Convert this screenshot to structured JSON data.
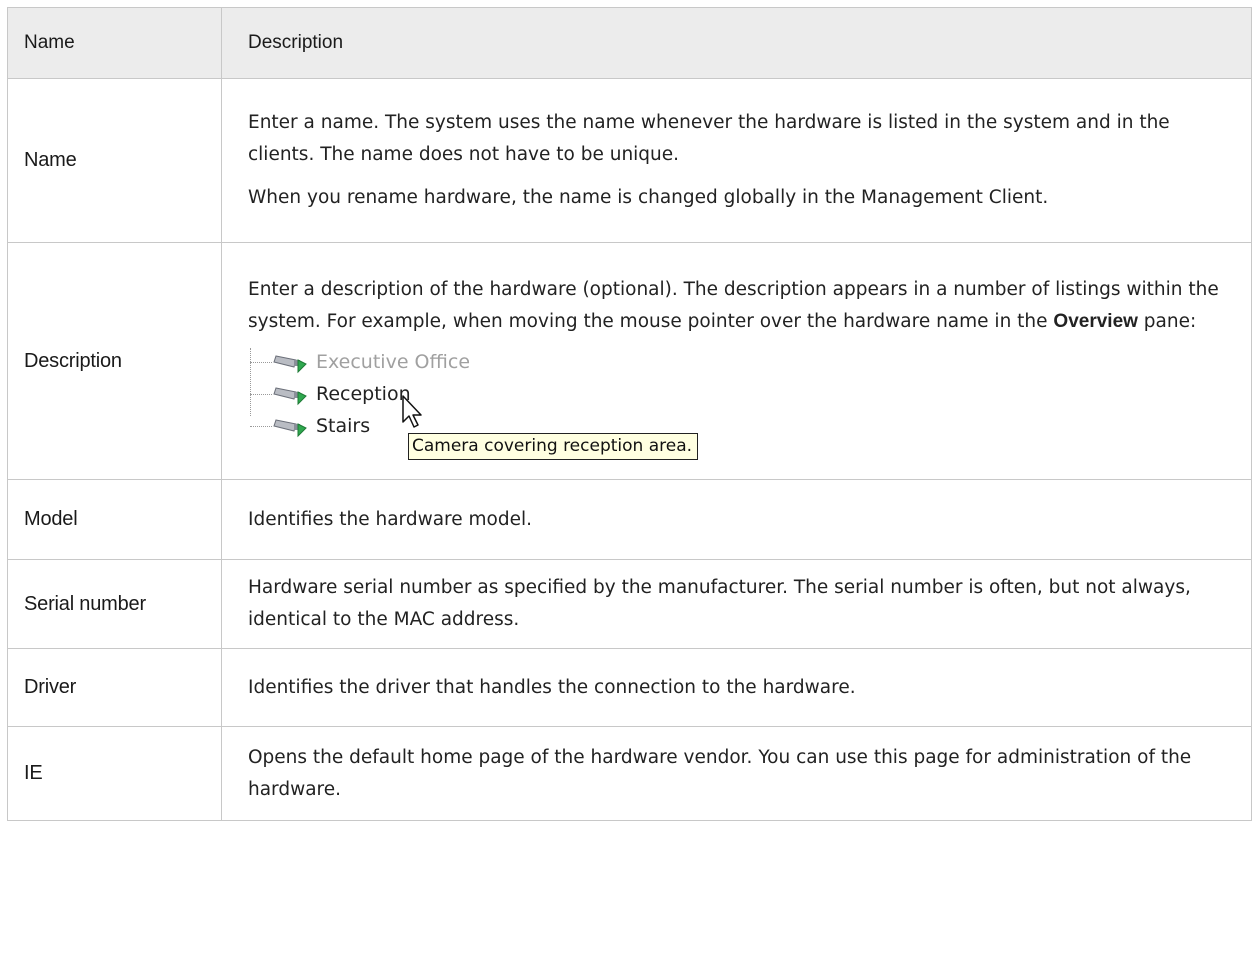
{
  "header": {
    "name_col": "Name",
    "desc_col": "Description"
  },
  "rows": [
    {
      "name": "Name",
      "desc_p1": "Enter a name. The system uses the name whenever the hardware is listed in the system and in the clients. The name does not have to be unique.",
      "desc_p2": "When you rename hardware, the name is changed globally in the Management Client."
    },
    {
      "name": "Description",
      "desc_pre": "Enter a description of the hardware (optional). The description appears in a number of listings within the system. For example, when moving the mouse pointer over the hardware name in the ",
      "desc_bold": "Overview",
      "desc_post": " pane:",
      "illustration": {
        "items": [
          "Executive Office",
          "Reception",
          "Stairs"
        ],
        "tooltip": "Camera covering reception area."
      }
    },
    {
      "name": "Model",
      "desc": "Identifies the hardware model."
    },
    {
      "name": "Serial number",
      "desc": "Hardware serial number as specified by the manufacturer. The serial number is often, but not always, identical to the MAC address."
    },
    {
      "name": "Driver",
      "desc": "Identifies the driver that handles the connection to the hardware."
    },
    {
      "name": "IE",
      "desc": "Opens the default home page of the hardware vendor. You can use this page for administration of the hardware."
    }
  ],
  "icons": {
    "tree_item": "camera-icon",
    "pointer": "mouse-cursor-icon"
  }
}
